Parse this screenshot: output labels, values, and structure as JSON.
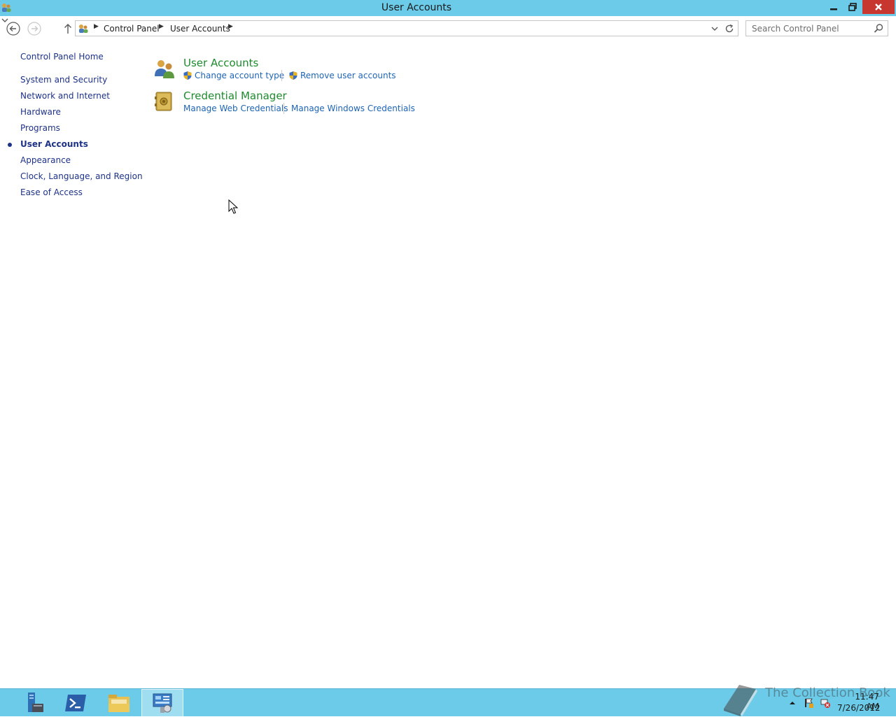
{
  "window": {
    "title": "User Accounts"
  },
  "breadcrumb": {
    "items": [
      "Control Panel",
      "User Accounts"
    ]
  },
  "search": {
    "placeholder": "Search Control Panel"
  },
  "leftnav": {
    "home": "Control Panel Home",
    "items": [
      {
        "label": "System and Security",
        "active": false
      },
      {
        "label": "Network and Internet",
        "active": false
      },
      {
        "label": "Hardware",
        "active": false
      },
      {
        "label": "Programs",
        "active": false
      },
      {
        "label": "User Accounts",
        "active": true
      },
      {
        "label": "Appearance",
        "active": false
      },
      {
        "label": "Clock, Language, and Region",
        "active": false
      },
      {
        "label": "Ease of Access",
        "active": false
      }
    ]
  },
  "categories": [
    {
      "title": "User Accounts",
      "icon": "users-icon",
      "tasks": [
        {
          "label": "Change account type",
          "shield": true
        },
        {
          "label": "Remove user accounts",
          "shield": true
        }
      ]
    },
    {
      "title": "Credential Manager",
      "icon": "vault-icon",
      "tasks": [
        {
          "label": "Manage Web Credentials",
          "shield": false
        },
        {
          "label": "Manage Windows Credentials",
          "shield": false
        }
      ]
    }
  ],
  "taskbar": {
    "watermark": "The Collection Book",
    "time": "11:47 AM",
    "date": "7/26/2012"
  },
  "colors": {
    "titlebar": "#6ccbe9",
    "close": "#c7372f",
    "link": "#1e64b4",
    "category": "#1e8a2e",
    "nav": "#1e3287"
  }
}
